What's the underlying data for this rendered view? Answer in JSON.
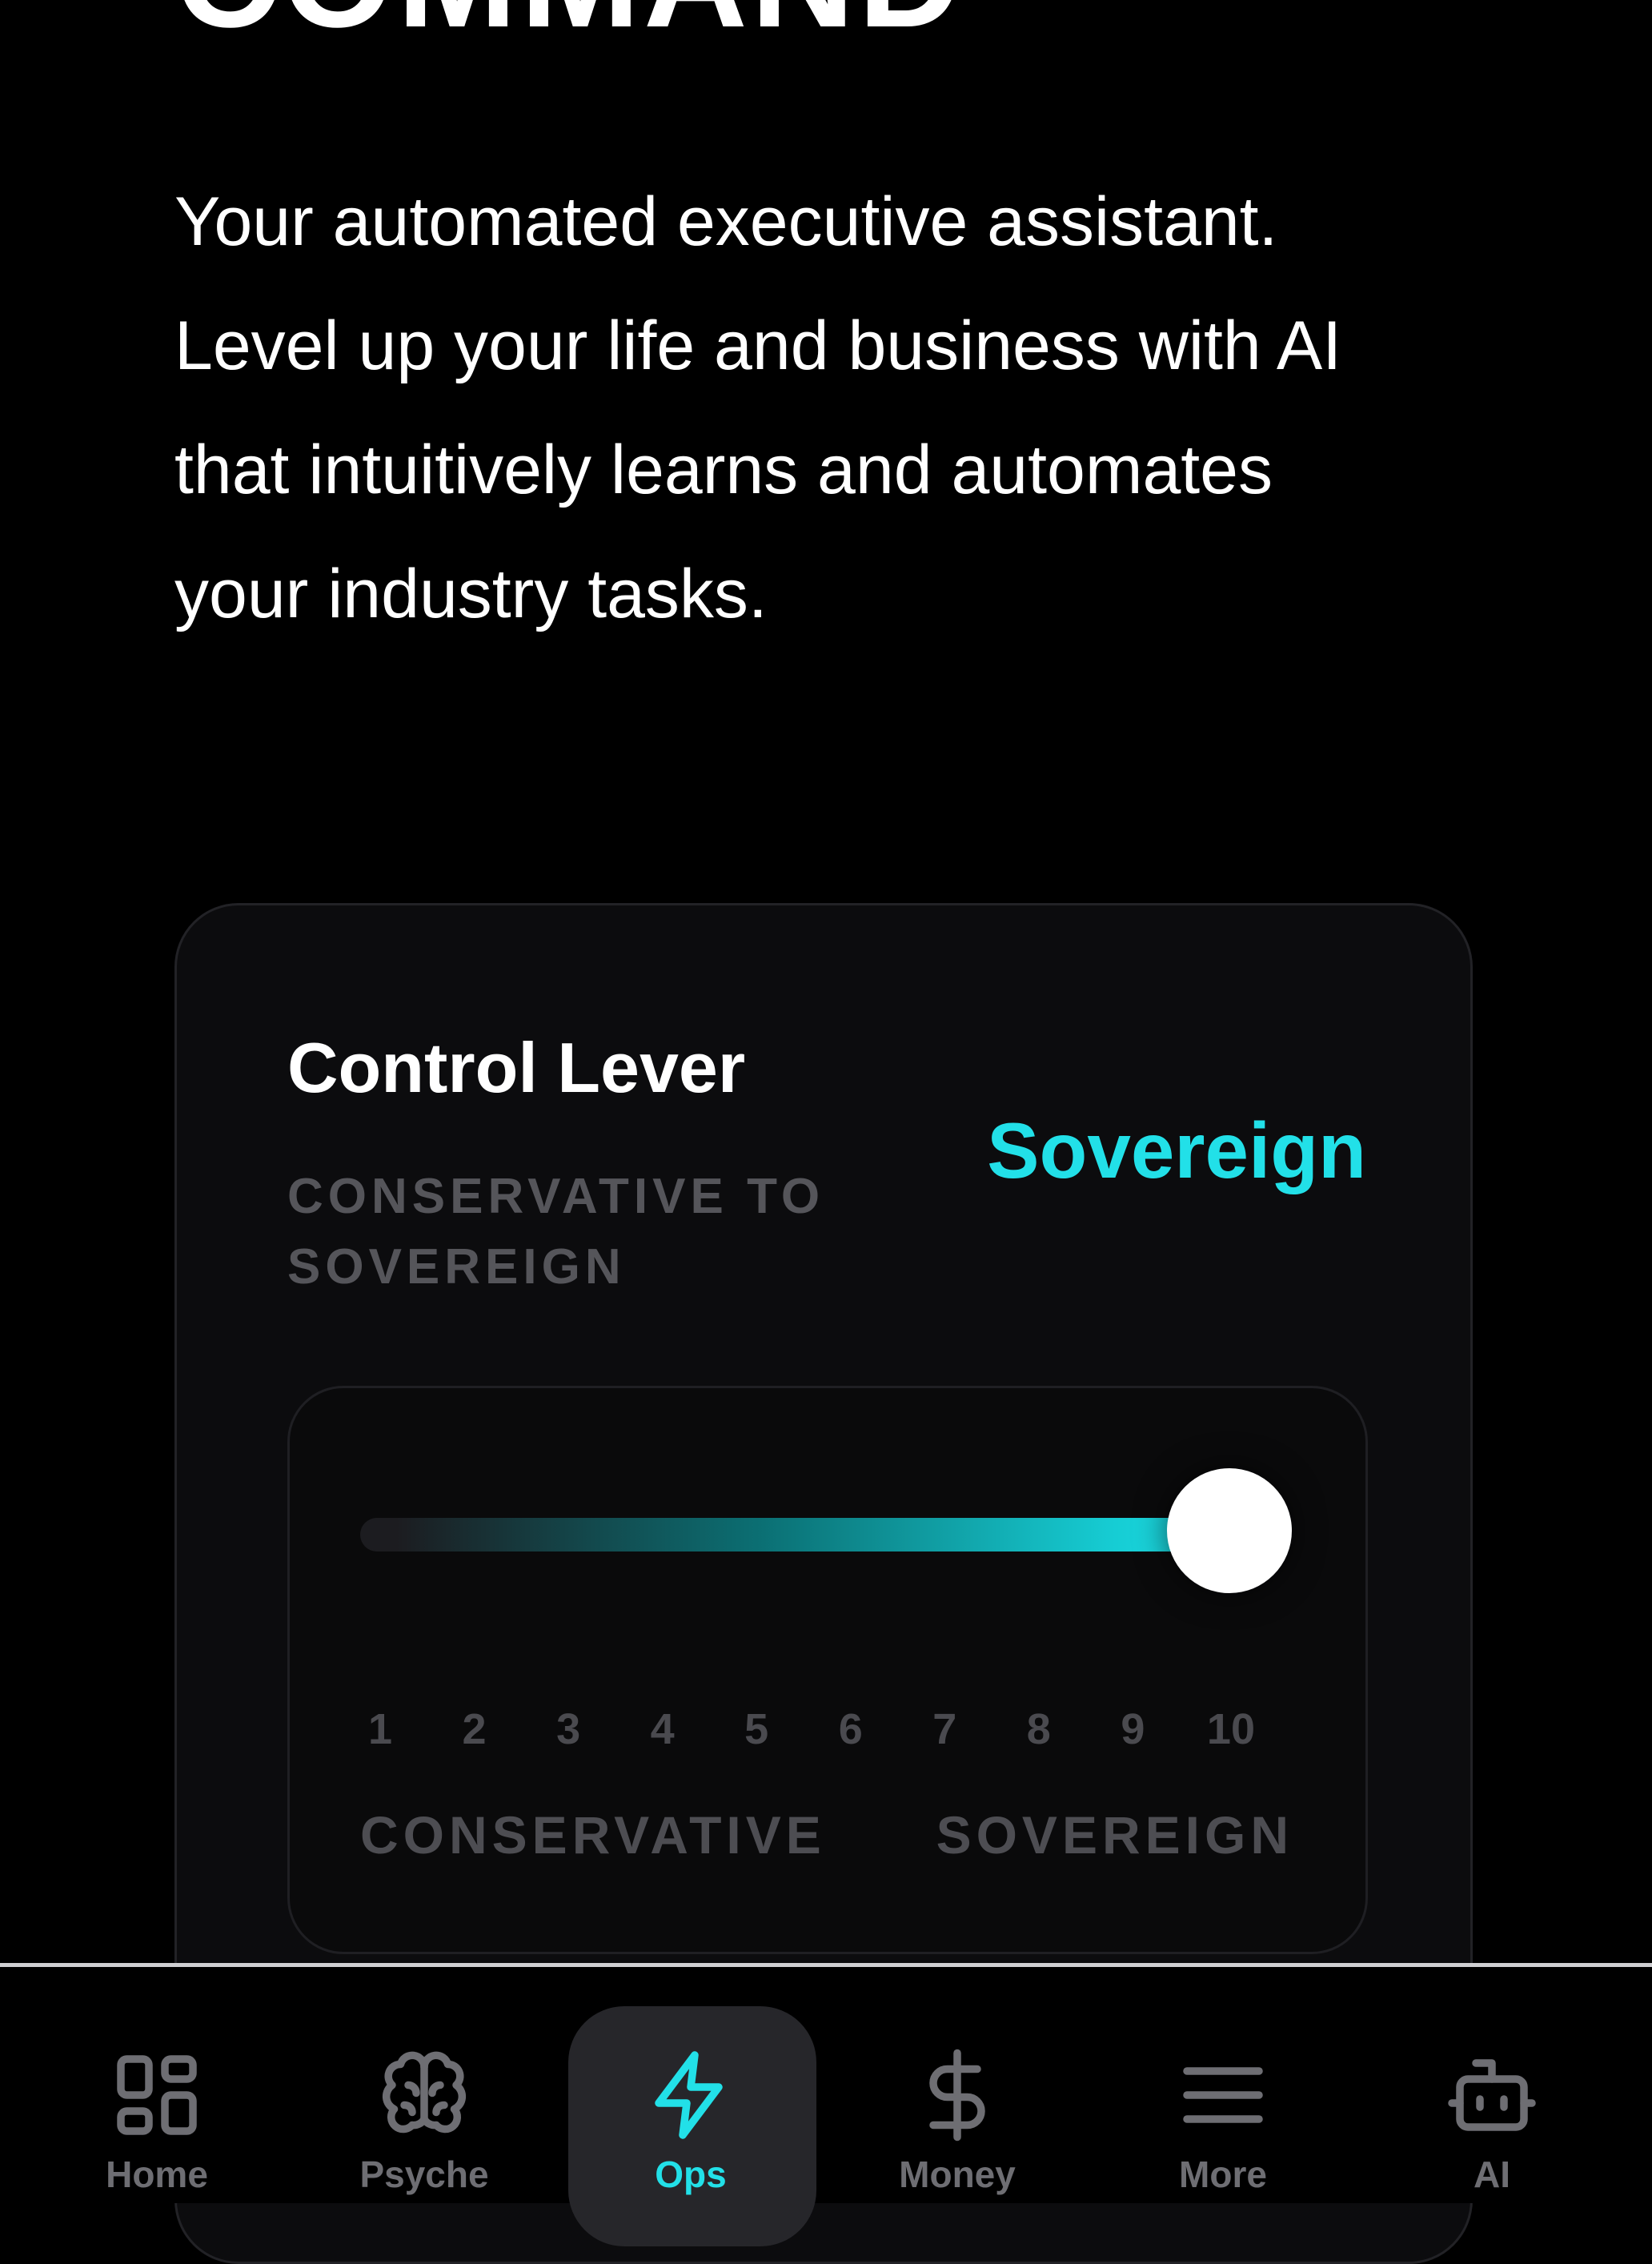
{
  "header": {
    "title": "COMMAND",
    "intro": "Your automated executive assistant. Level up your life and business with AI that intuitively learns and automates your industry tasks."
  },
  "control_lever": {
    "title": "Control Lever",
    "subtitle": "CONSERVATIVE TO SOVEREIGN",
    "current_label": "Sovereign",
    "slider": {
      "value": 10,
      "min": 1,
      "max": 10,
      "ticks": [
        "1",
        "2",
        "3",
        "4",
        "5",
        "6",
        "7",
        "8",
        "9",
        "10"
      ],
      "left_label": "CONSERVATIVE",
      "right_label": "SOVEREIGN"
    },
    "accent_color": "#22e0e8"
  },
  "nav": {
    "active": "Ops",
    "items": [
      {
        "label": "Home",
        "icon": "grid-icon"
      },
      {
        "label": "Psyche",
        "icon": "brain-icon"
      },
      {
        "label": "Ops",
        "icon": "lightning-icon"
      },
      {
        "label": "Money",
        "icon": "dollar-icon"
      },
      {
        "label": "More",
        "icon": "menu-icon"
      },
      {
        "label": "AI",
        "icon": "robot-icon"
      }
    ]
  }
}
